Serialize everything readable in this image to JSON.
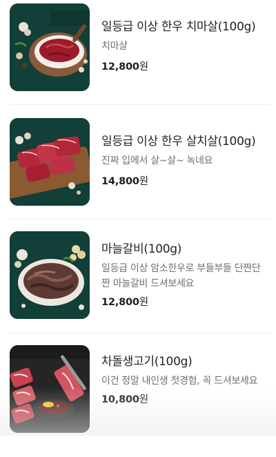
{
  "products": [
    {
      "title": "일등급 이상 한우 치마살(100g)",
      "description": "치마살",
      "price": "12,800",
      "currency": "원"
    },
    {
      "title": "일등급 이상 한우 살치살(100g)",
      "description": "진짜 입에서 살~살~ 녹네요",
      "price": "14,800",
      "currency": "원"
    },
    {
      "title": "마늘갈비(100g)",
      "description": "일등급 이상 암소한우로 부들부들 단짠단짠 마늘갈비 드셔보세요",
      "price": "12,800",
      "currency": "원"
    },
    {
      "title": "차돌생고기(100g)",
      "description": "이건 정말 내인생 첫경험, 꼭 드셔보세요",
      "price": "10,800",
      "currency": "원"
    }
  ],
  "colors": {
    "thumb_background": "#123f37",
    "divider": "#ececec",
    "description_text": "#6e6e6e"
  }
}
